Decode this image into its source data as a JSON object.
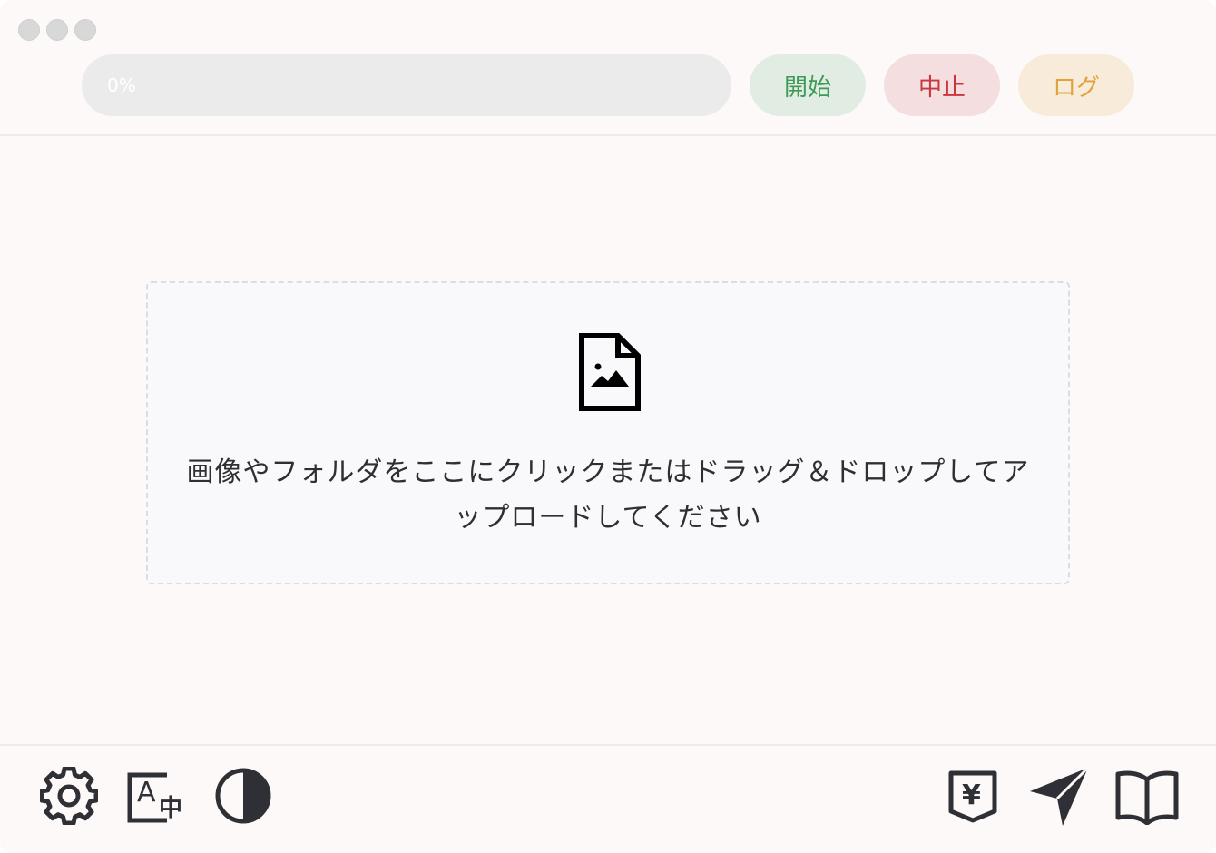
{
  "window": {
    "controls": [
      "close",
      "minimize",
      "maximize"
    ]
  },
  "toolbar": {
    "progress_value": 0,
    "progress_label": "0%",
    "start_label": "開始",
    "stop_label": "中止",
    "log_label": "ログ"
  },
  "dropzone": {
    "icon": "image-file-icon",
    "instruction": "画像やフォルダをここにクリックまたはドラッグ＆ドロップしてアップロードしてください"
  },
  "footer": {
    "left_icons": [
      "gear-icon",
      "translate-icon",
      "contrast-icon"
    ],
    "right_icons": [
      "yen-icon",
      "send-icon",
      "book-icon"
    ]
  },
  "colors": {
    "background": "#fdf9f8",
    "start": "#3f9a58",
    "stop": "#c8363e",
    "log": "#e0a33c",
    "icon": "#2f3035"
  }
}
